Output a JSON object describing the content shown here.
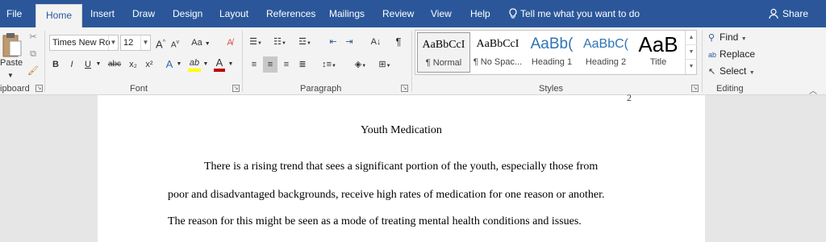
{
  "tabs": [
    {
      "label": "File",
      "active": false
    },
    {
      "label": "Home",
      "active": true
    },
    {
      "label": "Insert",
      "active": false
    },
    {
      "label": "Draw",
      "active": false
    },
    {
      "label": "Design",
      "active": false
    },
    {
      "label": "Layout",
      "active": false
    },
    {
      "label": "References",
      "active": false
    },
    {
      "label": "Mailings",
      "active": false
    },
    {
      "label": "Review",
      "active": false
    },
    {
      "label": "View",
      "active": false
    },
    {
      "label": "Help",
      "active": false
    }
  ],
  "tell_me": "Tell me what you want to do",
  "share_label": "Share",
  "clipboard": {
    "paste_label": "Paste",
    "group_label": "ipboard"
  },
  "font": {
    "name": "Times New Ro",
    "size": "12",
    "group_label": "Font",
    "grow": "A",
    "shrink": "A",
    "case": "Aa",
    "bold": "B",
    "italic": "I",
    "underline": "U",
    "strike": "abc",
    "subscript": "x₂",
    "superscript": "x²",
    "effects": "A",
    "highlight": "ab",
    "color": "A"
  },
  "paragraph": {
    "group_label": "Paragraph",
    "pilcrow": "¶"
  },
  "styles": {
    "group_label": "Styles",
    "items": [
      {
        "preview": "AaBbCcI",
        "name": "¶ Normal"
      },
      {
        "preview": "AaBbCcI",
        "name": "¶ No Spac..."
      },
      {
        "preview": "AaBb(",
        "name": "Heading 1"
      },
      {
        "preview": "AaBbC(",
        "name": "Heading 2"
      },
      {
        "preview": "AaB",
        "name": "Title"
      }
    ]
  },
  "editing": {
    "find": "Find",
    "replace": "Replace",
    "select": "Select",
    "group_label": "Editing"
  },
  "document": {
    "page_number": "2",
    "title": "Youth Medication",
    "lines": [
      "There is a rising trend that sees a significant portion of the youth, especially those from",
      "poor and disadvantaged backgrounds, receive high rates of medication for one reason or another.",
      "The reason for this might be seen as a mode of treating mental health conditions and issues."
    ]
  },
  "colors": {
    "accent": "#2b579a",
    "ribbon": "#f3f3f3",
    "canvas": "#e6e6e6",
    "font_color_bar": "#c00000",
    "highlight_bar": "#ffff00"
  }
}
